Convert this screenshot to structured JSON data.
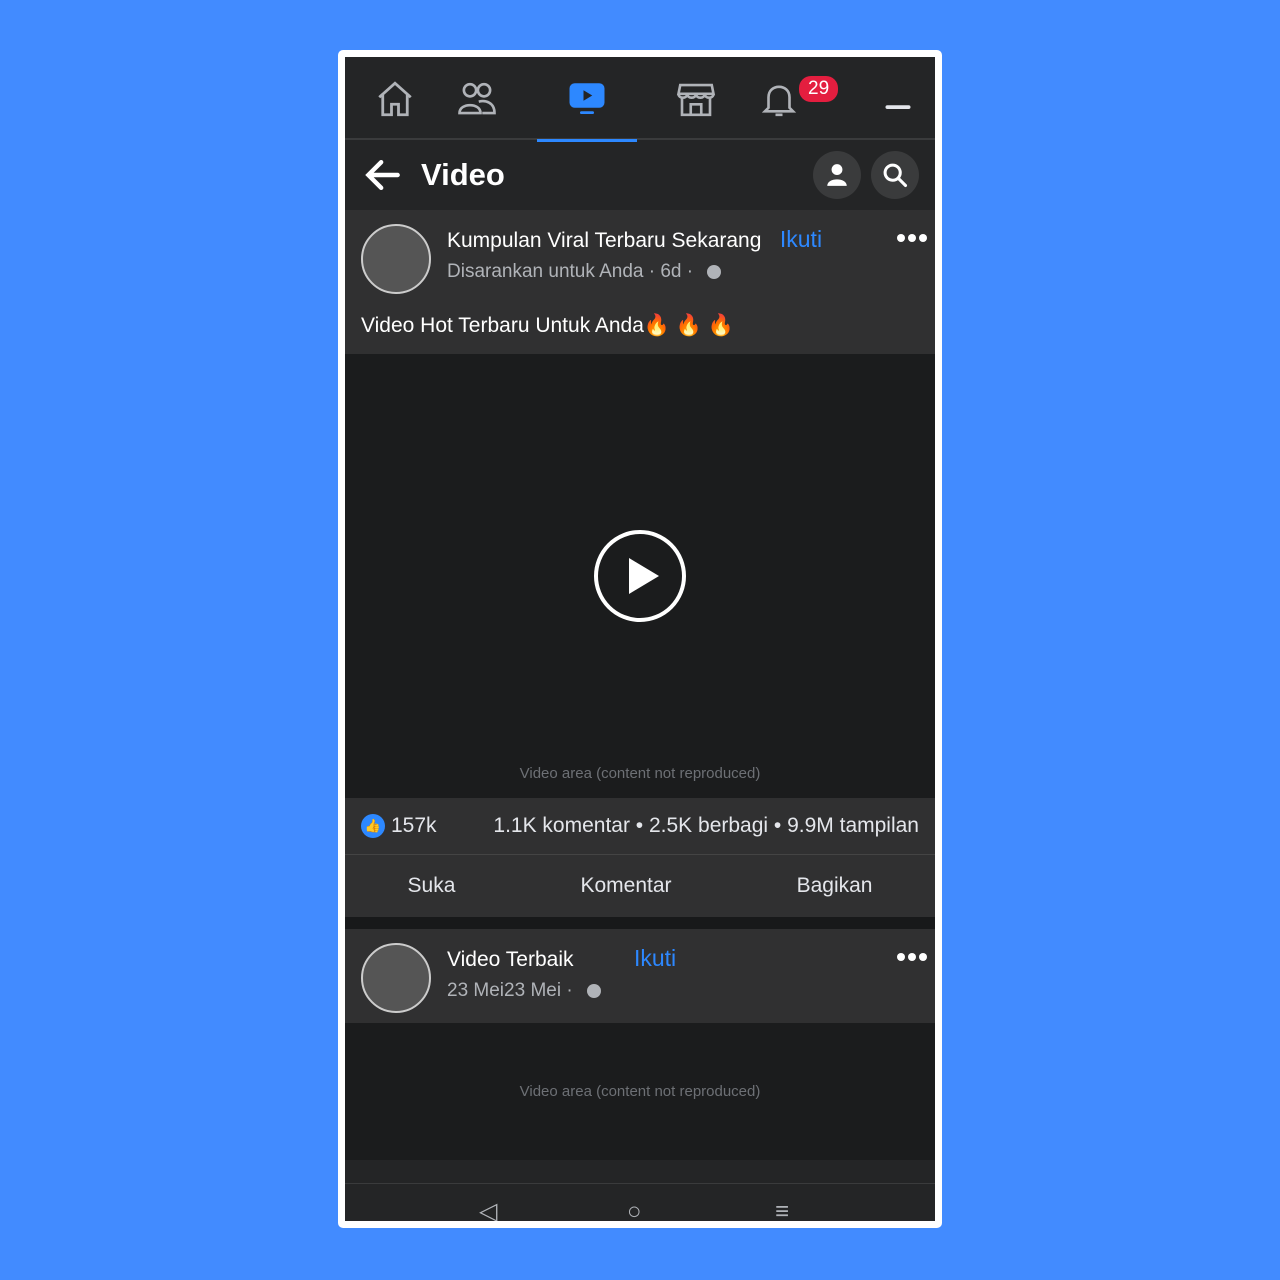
{
  "nav": {
    "icons": [
      "home-icon",
      "friends-icon",
      "watch-icon",
      "marketplace-icon",
      "bell-icon",
      "menu-icon"
    ],
    "notification_count": "29"
  },
  "header": {
    "title": "Video"
  },
  "post1": {
    "page_name": "Kumpulan Viral Terbaru Sekarang",
    "follow": "Ikuti",
    "subtitle": "Disarankan untuk Anda · 6d ·",
    "caption": "Video Hot Terbaru Untuk Anda🔥 🔥 🔥",
    "video_placeholder": "Video area (content not reproduced)",
    "stats": {
      "likes": "157k",
      "summary": "1.1K komentar • 2.5K berbagi • 9.9M tampilan"
    },
    "actions": {
      "like": "Suka",
      "comment": "Komentar",
      "share": "Bagikan"
    }
  },
  "post2": {
    "page_name": "Video Terbaik",
    "follow": "Ikuti",
    "subtitle": "23 Mei23 Mei ·",
    "video_placeholder": "Video area (content not reproduced)"
  },
  "colors": {
    "accent": "#2d88ff",
    "background": "#428bff",
    "dark": "#242526",
    "badge": "#e41e3f"
  }
}
